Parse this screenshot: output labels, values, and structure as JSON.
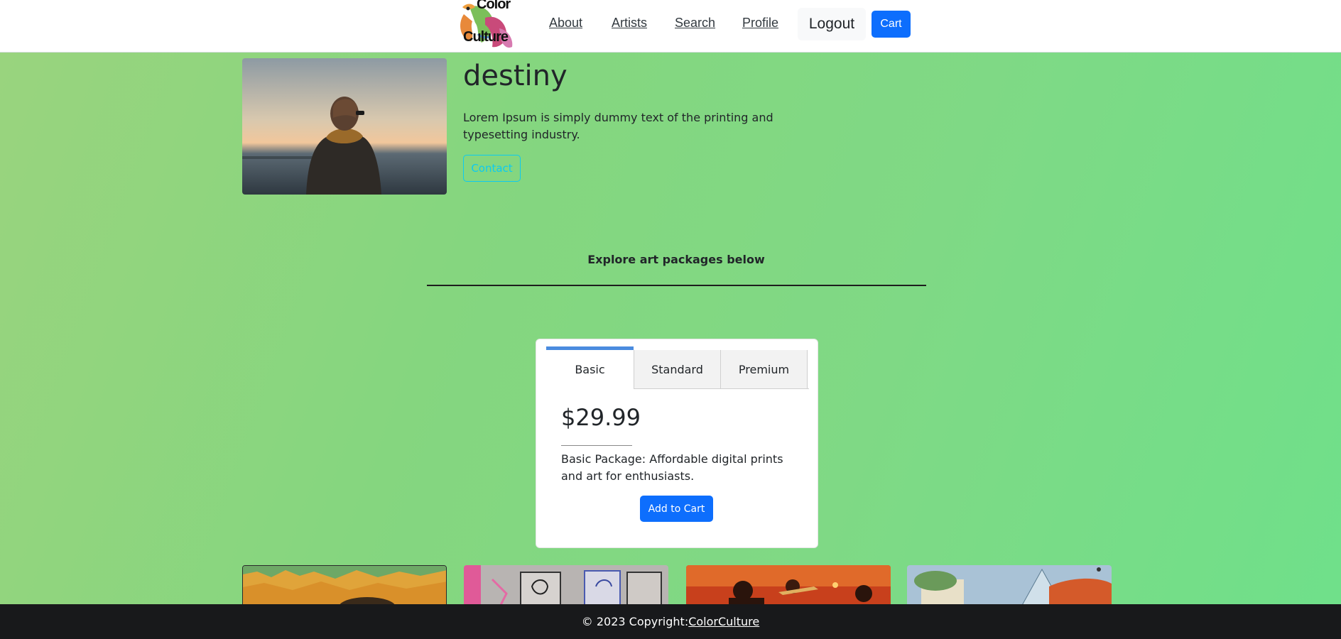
{
  "header": {
    "logo_line1": "Color",
    "logo_line2": "Culture",
    "nav": {
      "about": "About",
      "artists": "Artists",
      "search": "Search",
      "profile": "Profile"
    },
    "logout_label": "Logout",
    "cart_label": "Cart"
  },
  "profile": {
    "name": "destiny",
    "bio": "Lorem Ipsum is simply dummy text of the printing and typesetting industry.",
    "contact_label": "Contact"
  },
  "explore": {
    "title": "Explore art packages below"
  },
  "pricing": {
    "tabs": [
      "Basic",
      "Standard",
      "Premium"
    ],
    "active_tab": "Basic",
    "price": "$29.99",
    "description": "Basic Package: Affordable digital prints and art for enthusiasts.",
    "add_to_cart_label": "Add to Cart"
  },
  "footer": {
    "copyright": "© 2023 Copyright:",
    "link": "ColorCulture"
  },
  "colors": {
    "primary": "#0d6efd",
    "info": "#0dcaf0",
    "tab_accent": "#4a8bdf",
    "footer_bg": "#18191b"
  }
}
